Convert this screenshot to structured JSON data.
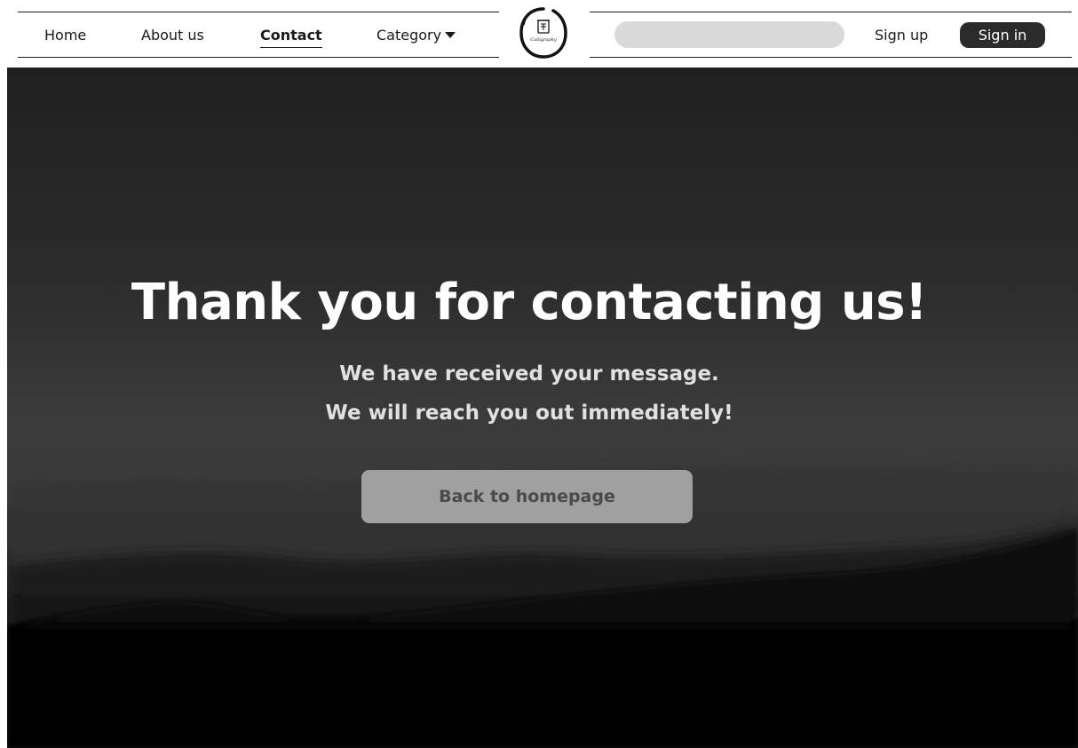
{
  "nav": {
    "links": [
      {
        "label": "Home"
      },
      {
        "label": "About us"
      },
      {
        "label": "Contact"
      },
      {
        "label": "Category"
      }
    ],
    "logo_text": "Calligraphy",
    "search_placeholder": "",
    "signup_label": "Sign up",
    "signin_label": "Sign in",
    "icons": {
      "category_caret": "caret-down-icon",
      "logo": "calligraphy-logo"
    }
  },
  "hero": {
    "title": "Thank you for contacting us!",
    "subtitle_line1": "We have received your message.",
    "subtitle_line2": "We will reach you out immediately!",
    "button_label": "Back to homepage"
  },
  "colors": {
    "nav_bg": "#ffffff",
    "text_dark": "#1a1a1a",
    "signin_bg": "#2b2b2b",
    "search_bg": "#dadada",
    "hero_text": "#ffffff",
    "button_bg": "#a0a0a0",
    "button_text": "#4a4a4a"
  }
}
